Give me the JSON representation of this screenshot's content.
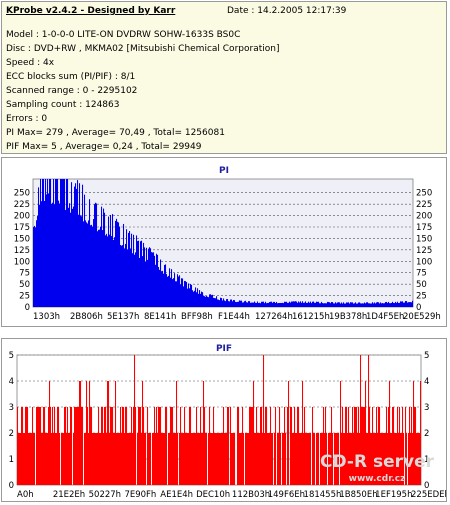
{
  "header": {
    "app": "KProbe v2.4.2 - Designed by Karr",
    "date": "Date : 14.2.2005 12:17:39",
    "lines": [
      "Model : 1-0-0-0 LITE-ON DVDRW SOHW-1633S BS0C",
      "Disc : DVD+RW , MKMA02 [Mitsubishi Chemical Corporation]",
      "Speed : 4x",
      "ECC blocks sum (PI/PIF) : 8/1",
      "Scanned range : 0 - 2295102",
      "Sampling count : 124863",
      "Errors : 0",
      "PI Max= 279 , Average= 70,49 , Total= 1256081",
      "PIF Max= 5 , Average= 0,24 , Total= 29949"
    ]
  },
  "colors": {
    "pi": "#0000ee",
    "pi_bg": "#efeff8",
    "pif": "#ff0000",
    "pif_bg": "#ffffff",
    "title": "#1f1fa0"
  },
  "chart_data": [
    {
      "type": "area",
      "title": "PI",
      "ylim": [
        0,
        280
      ],
      "yticks": [
        0,
        25,
        50,
        75,
        100,
        125,
        150,
        175,
        200,
        225,
        250
      ],
      "xticks": [
        "1303h",
        "2B806h",
        "5E137h",
        "8E141h",
        "BFF98h",
        "F1E44h",
        "127264h",
        "161215h",
        "19B378h",
        "1D4F5Eh",
        "20E529h"
      ],
      "grid": true,
      "series": [
        {
          "x": [
            0,
            0.02,
            0.05,
            0.1,
            0.15,
            0.2,
            0.25,
            0.3,
            0.35,
            0.4,
            0.45,
            0.5,
            0.55,
            0.6,
            0.65,
            0.7,
            0.75,
            0.8,
            0.85,
            0.9,
            0.95,
            1.0
          ],
          "values": [
            190,
            262,
            275,
            245,
            215,
            180,
            148,
            115,
            82,
            50,
            28,
            16,
            12,
            10,
            10,
            11,
            10,
            9,
            9,
            9,
            10,
            12
          ]
        }
      ]
    },
    {
      "type": "bar",
      "title": "PIF",
      "ylim": [
        0,
        5
      ],
      "yticks": [
        0,
        1,
        2,
        3,
        4,
        5
      ],
      "xticks": [
        "A0h",
        "21E2Eh",
        "50227h",
        "7E90Fh",
        "AE1E4h",
        "DEC10h",
        "112B03h",
        "149F6Eh",
        "181455h",
        "1B850Eh",
        "1EF195h",
        "225EDEh"
      ],
      "grid": true,
      "series": [
        {
          "base_level": 2,
          "frequent_level": 3,
          "occasional_level": 4,
          "max_level": 5,
          "max_at": [
            0.29,
            0.61,
            0.85,
            0.87
          ]
        }
      ]
    }
  ],
  "watermark": "CD-R server",
  "site": "www.cdr.cz"
}
